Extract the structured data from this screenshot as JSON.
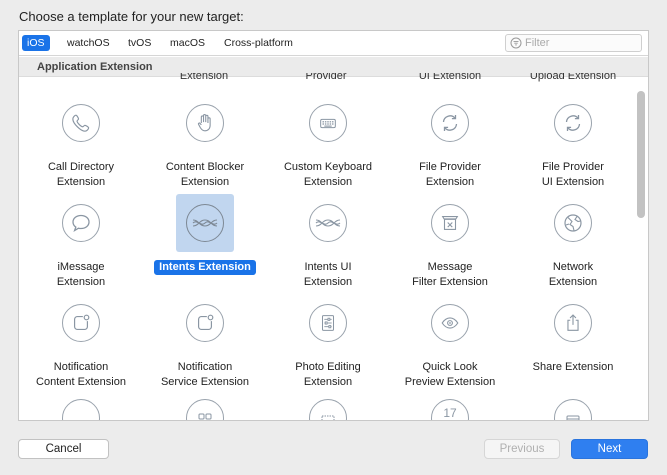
{
  "dialog": {
    "heading": "Choose a template for your new target:"
  },
  "platform_tabs": [
    {
      "label": "iOS",
      "selected": true
    },
    {
      "label": "watchOS",
      "selected": false
    },
    {
      "label": "tvOS",
      "selected": false
    },
    {
      "label": "macOS",
      "selected": false
    },
    {
      "label": "Cross-platform",
      "selected": false
    }
  ],
  "filter": {
    "placeholder": "Filter",
    "icon": "filter-icon"
  },
  "section": {
    "title": "Application Extension"
  },
  "partial_row_labels": [
    "Extension",
    "Provider",
    "UI Extension",
    "Upload Extension"
  ],
  "templates": [
    {
      "line1": "Call Directory",
      "line2": "Extension",
      "icon": "phone-icon"
    },
    {
      "line1": "Content Blocker",
      "line2": "Extension",
      "icon": "hand-icon"
    },
    {
      "line1": "Custom Keyboard",
      "line2": "Extension",
      "icon": "keyboard-icon"
    },
    {
      "line1": "File Provider",
      "line2": "Extension",
      "icon": "sync-icon"
    },
    {
      "line1": "File Provider",
      "line2": "UI Extension",
      "icon": "sync-icon"
    },
    {
      "line1": "iMessage",
      "line2": "Extension",
      "icon": "message-bubble-icon"
    },
    {
      "line1": "Intents Extension",
      "line2": "",
      "icon": "intents-icon",
      "selected": true
    },
    {
      "line1": "Intents UI",
      "line2": "Extension",
      "icon": "intents-icon"
    },
    {
      "line1": "Message",
      "line2": "Filter Extension",
      "icon": "message-filter-icon"
    },
    {
      "line1": "Network",
      "line2": "Extension",
      "icon": "globe-icon"
    },
    {
      "line1": "Notification",
      "line2": "Content Extension",
      "icon": "notification-icon"
    },
    {
      "line1": "Notification",
      "line2": "Service Extension",
      "icon": "notification-icon"
    },
    {
      "line1": "Photo Editing",
      "line2": "Extension",
      "icon": "sliders-icon"
    },
    {
      "line1": "Quick Look",
      "line2": "Preview Extension",
      "icon": "eye-icon"
    },
    {
      "line1": "Share Extension",
      "line2": "",
      "icon": "share-icon"
    }
  ],
  "bottom_partial_icons": [
    {
      "icon": "circle-icon",
      "text": ""
    },
    {
      "icon": "grid-icon",
      "text": ""
    },
    {
      "icon": "frame-icon",
      "text": ""
    },
    {
      "icon": "calendar-icon",
      "text": "17"
    },
    {
      "icon": "widget-icon",
      "text": ""
    }
  ],
  "buttons": {
    "cancel": "Cancel",
    "previous": "Previous",
    "next": "Next"
  }
}
